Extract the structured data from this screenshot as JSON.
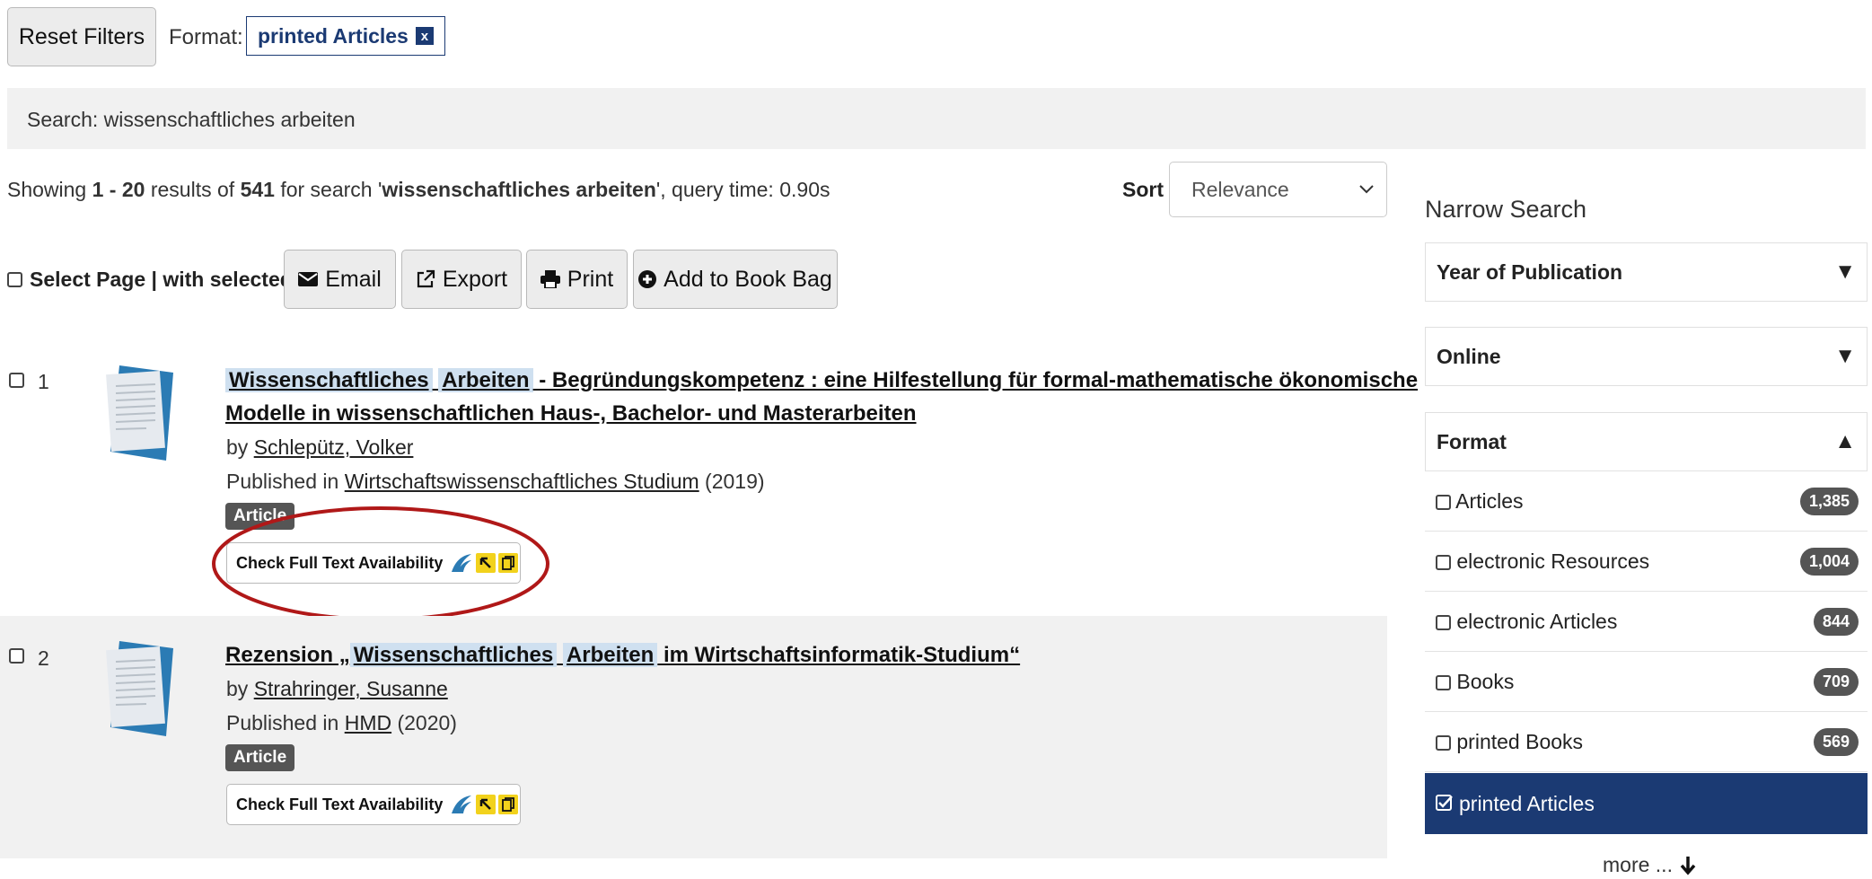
{
  "filters": {
    "reset_label": "Reset Filters",
    "format_label": "Format:",
    "format_value": "printed Articles",
    "remove_icon": "x"
  },
  "search_bar": {
    "text": "Search: wissenschaftliches arbeiten"
  },
  "summary": {
    "showing": "Showing ",
    "range": "1 - 20",
    "results_of": " results of ",
    "total": "541",
    "for_search": " for search '",
    "query": "wissenschaftliches arbeiten",
    "query_time": "', query time: 0.90s"
  },
  "sort": {
    "label": "Sort",
    "selected": "Relevance"
  },
  "bulk": {
    "select_label": "Select Page | with selected:",
    "email": "Email",
    "export": "Export",
    "print": "Print",
    "bookbag": "Add to Book Bag"
  },
  "results": [
    {
      "number": "1",
      "title_hl1": "Wissenschaftliches",
      "title_hl2": "Arbeiten",
      "title_rest_line1": " - Begründungskompetenz : eine Hilfestellung für formal-mathematische ökonomische",
      "title_line2": "Modelle in wissenschaftlichen Haus-, Bachelor- und Masterarbeiten",
      "by": "by ",
      "author": "Schlepütz, Volker",
      "published_in": "Published in ",
      "journal": "Wirtschaftswissenschaftliches Studium",
      "year": " (2019)",
      "badge": "Article",
      "fulltext": "Check Full Text Availability"
    },
    {
      "number": "2",
      "title_pre": "Rezension „",
      "title_hl1": "Wissenschaftliches",
      "title_hl2": "Arbeiten",
      "title_post": " im Wirtschaftsinformatik-Studium“",
      "by": "by ",
      "author": "Strahringer, Susanne",
      "published_in": "Published in ",
      "journal": "HMD",
      "year": " (2020)",
      "badge": "Article",
      "fulltext": "Check Full Text Availability"
    }
  ],
  "sidebar": {
    "heading": "Narrow Search",
    "facets": [
      {
        "label": "Year of Publication",
        "state": "collapsed"
      },
      {
        "label": "Online",
        "state": "collapsed"
      },
      {
        "label": "Format",
        "state": "expanded"
      }
    ],
    "format_items": [
      {
        "label": "Articles",
        "count": "1,385"
      },
      {
        "label": "electronic Resources",
        "count": "1,004"
      },
      {
        "label": "electronic Articles",
        "count": "844"
      },
      {
        "label": "Books",
        "count": "709"
      },
      {
        "label": "printed Books",
        "count": "569"
      },
      {
        "label": "printed Articles",
        "count": ""
      }
    ],
    "more": "more ..."
  },
  "colors": {
    "active_facet": "#1b3a73",
    "highlight": "#cfe0f0",
    "annotation_ellipse": "#b01818"
  }
}
